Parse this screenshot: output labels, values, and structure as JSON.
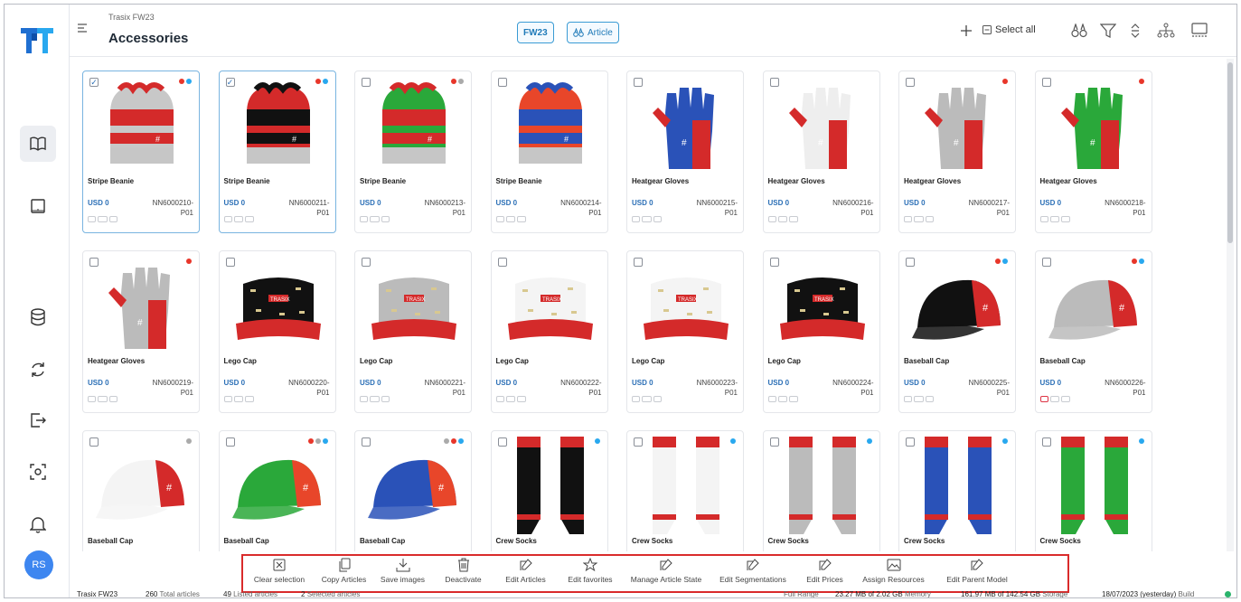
{
  "header": {
    "breadcrumb": "Trasix FW23",
    "title": "Accessories",
    "season_chip": "FW23",
    "article_chip": "Article",
    "select_all": "Select all"
  },
  "user": {
    "initials": "RS"
  },
  "colors": {
    "accent": "#3a9bd4",
    "brand": "#1f6fd1",
    "highlight": "#d92b2b"
  },
  "cards": [
    {
      "name": "Stripe Beanie",
      "price": "USD 0",
      "art": "NN6000210-",
      "suffix": "P01",
      "selected": true
    },
    {
      "name": "Stripe Beanie",
      "price": "USD 0",
      "art": "NN6000211-",
      "suffix": "P01",
      "selected": true
    },
    {
      "name": "Stripe Beanie",
      "price": "USD 0",
      "art": "NN6000213-",
      "suffix": "P01",
      "selected": false
    },
    {
      "name": "Stripe Beanie",
      "price": "USD 0",
      "art": "NN6000214-",
      "suffix": "P01",
      "selected": false
    },
    {
      "name": "Heatgear Gloves",
      "price": "USD 0",
      "art": "NN6000215-",
      "suffix": "P01",
      "selected": false
    },
    {
      "name": "Heatgear Gloves",
      "price": "USD 0",
      "art": "NN6000216-",
      "suffix": "P01",
      "selected": false
    },
    {
      "name": "Heatgear Gloves",
      "price": "USD 0",
      "art": "NN6000217-",
      "suffix": "P01",
      "selected": false
    },
    {
      "name": "Heatgear Gloves",
      "price": "USD 0",
      "art": "NN6000218-",
      "suffix": "P01",
      "selected": false
    },
    {
      "name": "Heatgear Gloves",
      "price": "USD 0",
      "art": "NN6000219-",
      "suffix": "P01",
      "selected": false
    },
    {
      "name": "Lego Cap",
      "price": "USD 0",
      "art": "NN6000220-",
      "suffix": "P01",
      "selected": false
    },
    {
      "name": "Lego Cap",
      "price": "USD 0",
      "art": "NN6000221-",
      "suffix": "P01",
      "selected": false
    },
    {
      "name": "Lego Cap",
      "price": "USD 0",
      "art": "NN6000222-",
      "suffix": "P01",
      "selected": false
    },
    {
      "name": "Lego Cap",
      "price": "USD 0",
      "art": "NN6000223-",
      "suffix": "P01",
      "selected": false
    },
    {
      "name": "Lego Cap",
      "price": "USD 0",
      "art": "NN6000224-",
      "suffix": "P01",
      "selected": false
    },
    {
      "name": "Baseball Cap",
      "price": "USD 0",
      "art": "NN6000225-",
      "suffix": "P01",
      "selected": false
    },
    {
      "name": "Baseball Cap",
      "price": "USD 0",
      "art": "NN6000226-",
      "suffix": "P01",
      "selected": false
    },
    {
      "name": "Baseball Cap",
      "price": "",
      "art": "",
      "suffix": "",
      "selected": false
    },
    {
      "name": "Baseball Cap",
      "price": "",
      "art": "",
      "suffix": "",
      "selected": false
    },
    {
      "name": "Baseball Cap",
      "price": "",
      "art": "",
      "suffix": "",
      "selected": false
    },
    {
      "name": "Crew Socks",
      "price": "",
      "art": "",
      "suffix": "",
      "selected": false
    },
    {
      "name": "Crew Socks",
      "price": "",
      "art": "",
      "suffix": "",
      "selected": false
    },
    {
      "name": "Crew Socks",
      "price": "",
      "art": "",
      "suffix": "",
      "selected": false
    },
    {
      "name": "Crew Socks",
      "price": "",
      "art": "",
      "suffix": "",
      "selected": false
    },
    {
      "name": "Crew Socks",
      "price": "",
      "art": "",
      "suffix": "",
      "selected": false
    }
  ],
  "actions": [
    {
      "label": "Clear selection",
      "icon": "close-box-icon"
    },
    {
      "label": "Copy Articles",
      "icon": "copy-icon"
    },
    {
      "label": "Save images",
      "icon": "download-icon"
    },
    {
      "label": "Deactivate",
      "icon": "trash-icon"
    },
    {
      "label": "Edit Articles",
      "icon": "edit-icon"
    },
    {
      "label": "Edit favorites",
      "icon": "star-icon"
    },
    {
      "label": "Manage Article State",
      "icon": "edit-icon"
    },
    {
      "label": "Edit Segmentations",
      "icon": "edit-icon"
    },
    {
      "label": "Edit Prices",
      "icon": "edit-icon"
    },
    {
      "label": "Assign Resources",
      "icon": "image-icon"
    },
    {
      "label": "Edit Parent Model",
      "icon": "edit-icon"
    }
  ],
  "status": {
    "catalog": "Trasix FW23",
    "total_count": "260",
    "total_label": "Total articles",
    "listed_count": "49",
    "listed_label": "Listed articles",
    "selected_count": "2",
    "selected_label": "Selected articles",
    "range": "Full Range",
    "memory_value": "23.27 MB of 2.02 GB",
    "memory_label": "Memory",
    "storage_value": "161.97 MB of 142.54 GB",
    "storage_label": "Storage",
    "build_value": "18/07/2023 (yesterday)",
    "build_label": "Build"
  }
}
